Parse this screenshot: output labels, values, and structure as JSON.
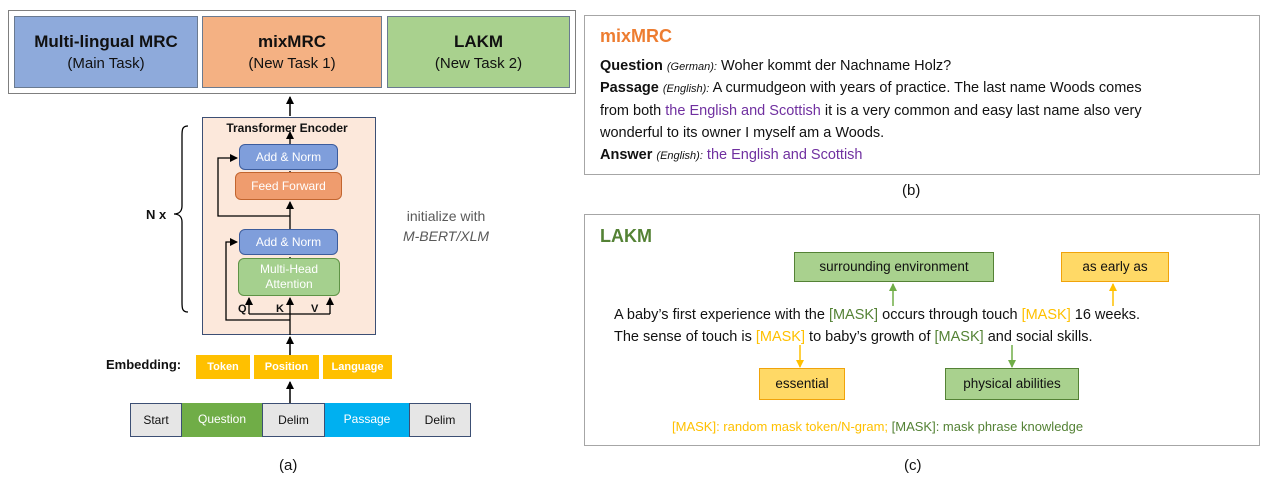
{
  "tasks": [
    {
      "title": "Multi-lingual MRC",
      "subtitle": "(Main Task)",
      "color": "#8eaadb"
    },
    {
      "title": "mixMRC",
      "subtitle": "(New Task 1)",
      "color": "#f4b183"
    },
    {
      "title": "LAKM",
      "subtitle": "(New Task 2)",
      "color": "#a9d18e"
    }
  ],
  "encoder": {
    "title": "Transformer Encoder",
    "add_norm_top": "Add & Norm",
    "feed_forward": "Feed Forward",
    "add_norm_bottom": "Add & Norm",
    "attention_line1": "Multi-Head",
    "attention_line2": "Attention",
    "q": "Q",
    "k": "K",
    "v": "V"
  },
  "nx_label": "N x",
  "init_line1": "initialize with",
  "init_line2": "M-BERT/XLM",
  "embedding": {
    "label": "Embedding:",
    "items": [
      "Token",
      "Position",
      "Language"
    ]
  },
  "tokens": [
    "Start",
    "Question",
    "Delim",
    "Passage",
    "Delim"
  ],
  "captions": {
    "a": "(a)",
    "b": "(b)",
    "c": "(c)"
  },
  "mixmrc": {
    "title": "mixMRC",
    "question_label": "Question",
    "question_lang": "(German):",
    "question_text": "Woher kommt der Nachname Holz?",
    "passage_label": "Passage",
    "passage_lang": "(English):",
    "passage_l1": "A curmudgeon with years of practice. The last name Woods comes",
    "passage_l2_a": "from both",
    "passage_l2_highlight": "the English and Scottish",
    "passage_l2_b": "it is a very common and easy last name also very",
    "passage_l3": "wonderful to its owner I myself am a Woods.",
    "answer_label": "Answer",
    "answer_lang": "(English):",
    "answer_text": "the English and Scottish"
  },
  "lakm": {
    "title": "LAKM",
    "box_surrounding": "surrounding environment",
    "box_early": "as early as",
    "box_essential": "essential",
    "box_physical": "physical abilities",
    "s1_a": "A baby’s first experience with the",
    "mask": "[MASK]",
    "s1_b": "occurs through touch",
    "s1_c": "16 weeks.",
    "s2_a": "The sense of touch is",
    "s2_b": "to baby’s growth of",
    "s2_c": "and social skills.",
    "legend_a": "[MASK]: random mask token/N-gram;",
    "legend_b": "[MASK]: mask phrase knowledge"
  },
  "colors": {
    "token_mask": "#ffc000",
    "phrase_mask": "#548235",
    "highlight": "#7030a0"
  }
}
